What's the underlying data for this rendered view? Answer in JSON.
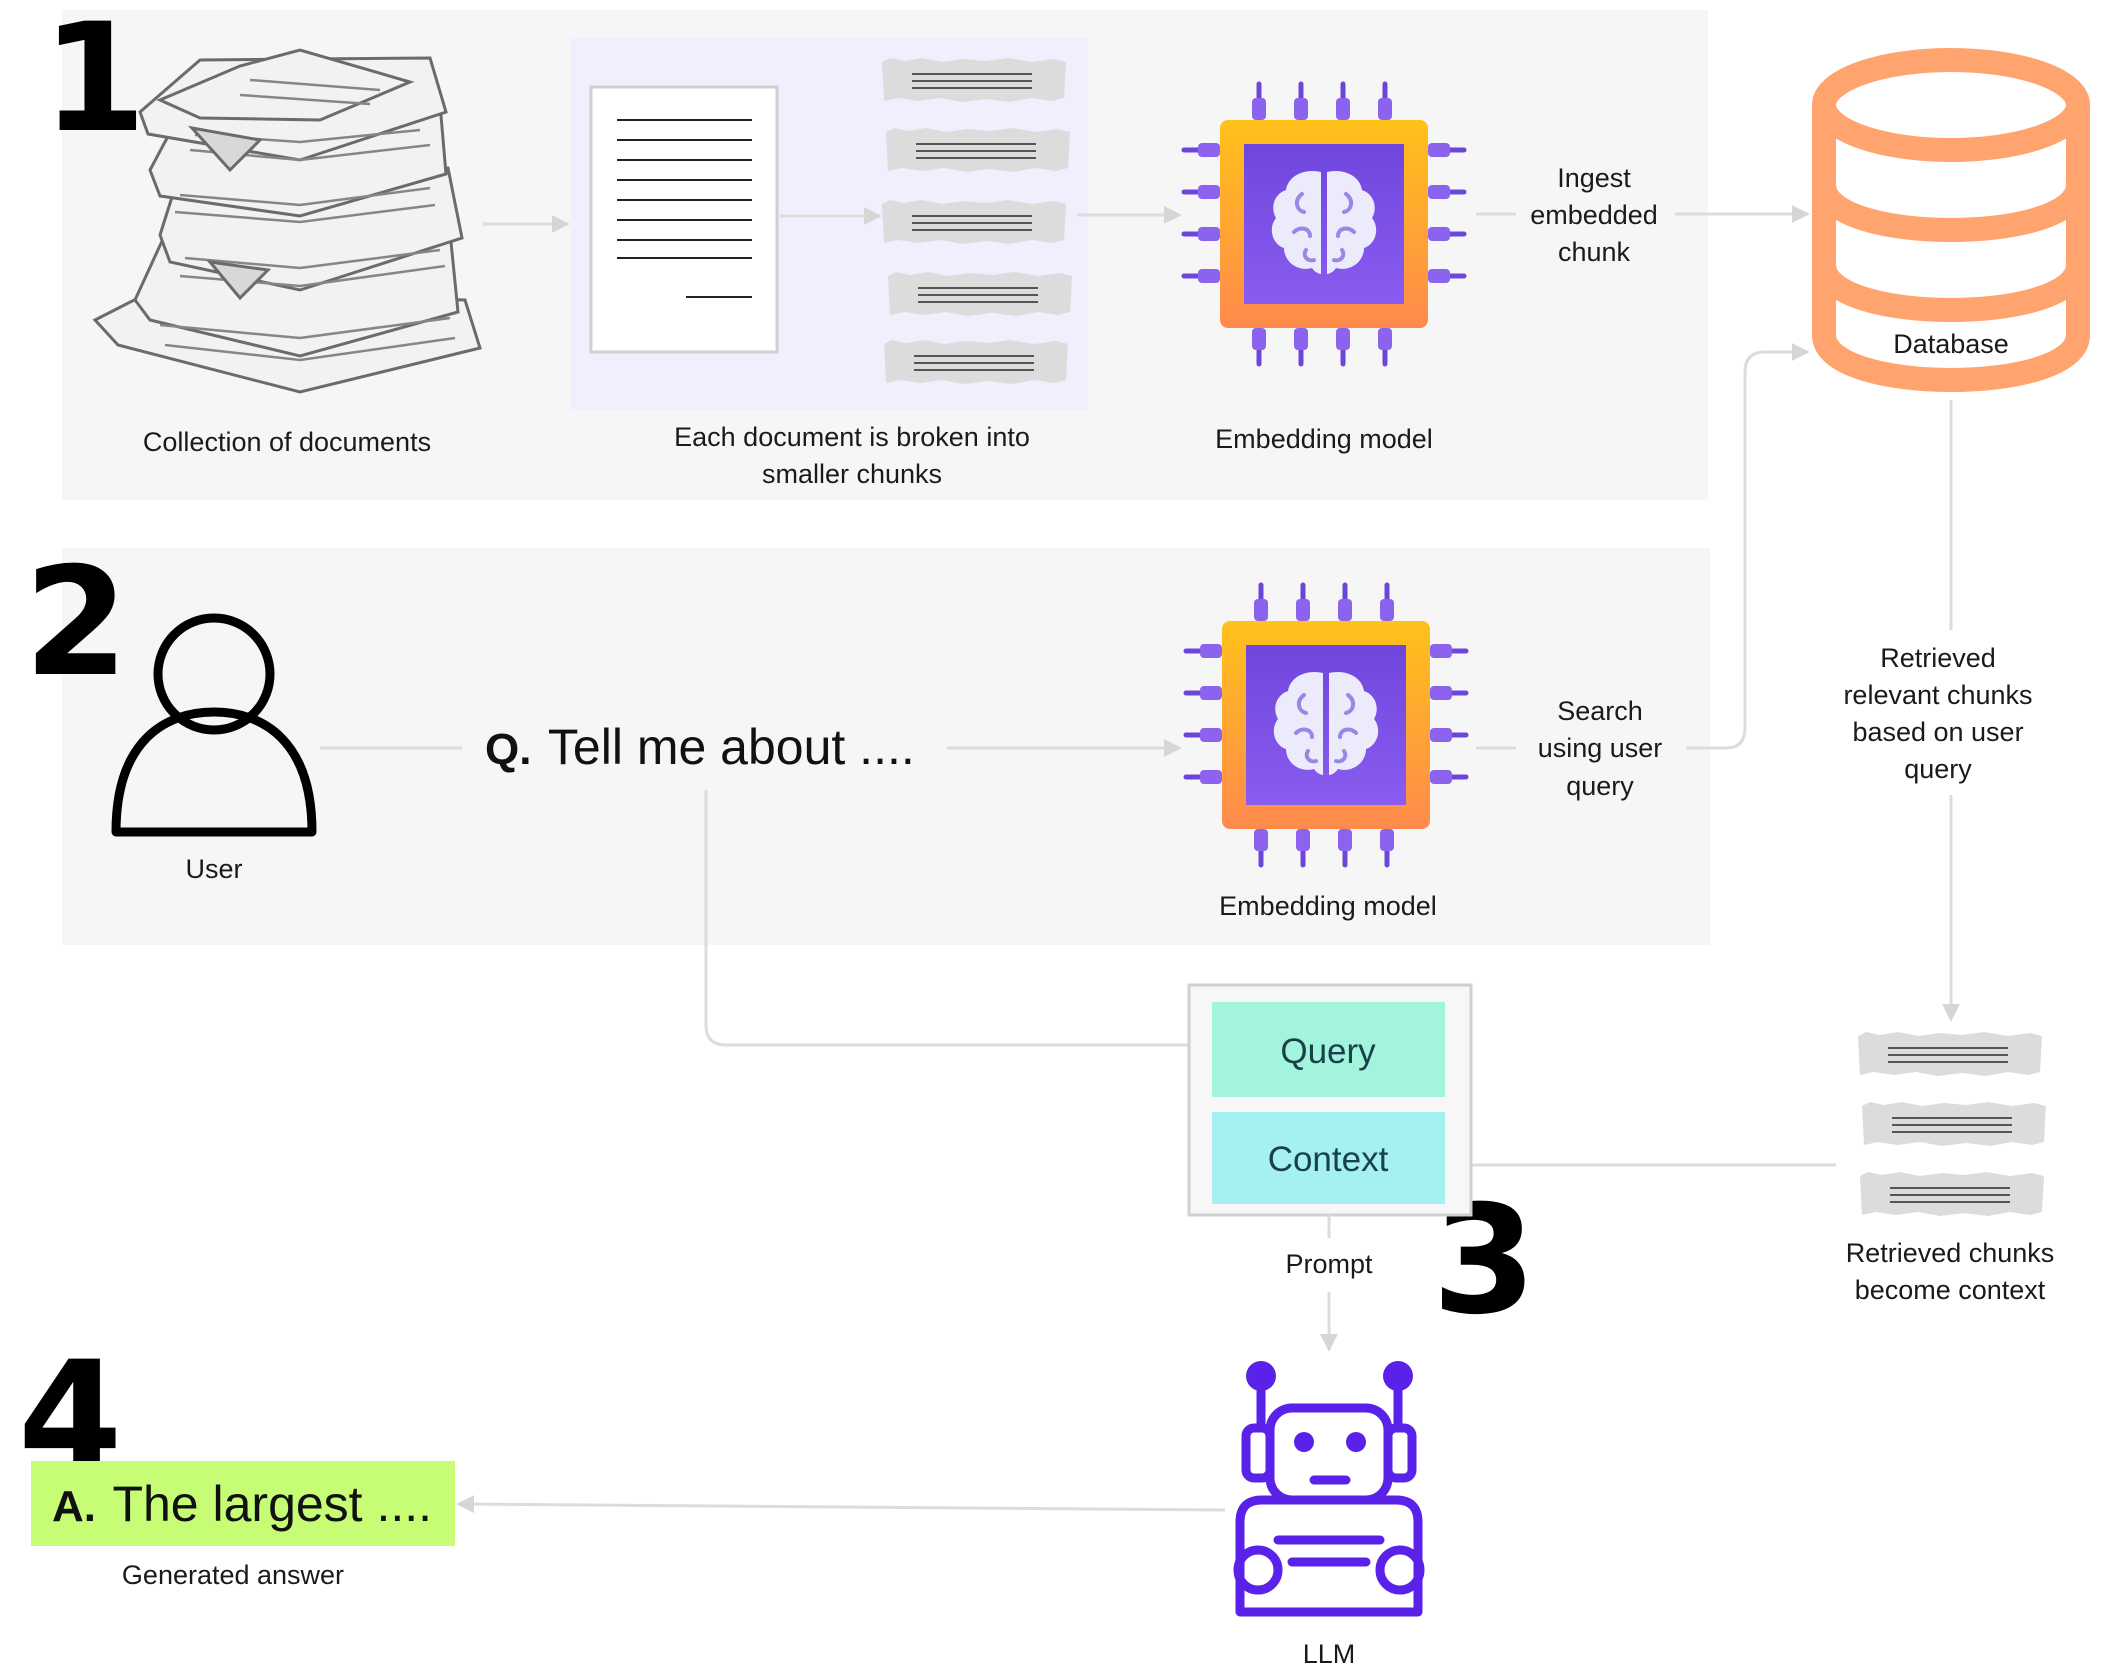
{
  "steps": {
    "one": "1",
    "two": "2",
    "three": "3",
    "four": "4"
  },
  "ingestion": {
    "documents_label": "Collection of  documents",
    "chunking_label_line1": "Each document is broken into",
    "chunking_label_line2": "smaller chunks",
    "embedding_label": "Embedding model",
    "ingest_line1": "Ingest",
    "ingest_line2": "embedded",
    "ingest_line3": "chunk",
    "database_label": "Database"
  },
  "query": {
    "user_label": "User",
    "question_prefix": "Q.",
    "question_text": "Tell me about ....",
    "embedding_label": "Embedding model",
    "search_line1": "Search",
    "search_line2": "using user",
    "search_line3": "query"
  },
  "retrieval": {
    "line1": "Retrieved",
    "line2": "relevant chunks",
    "line3": "based on user",
    "line4": "query",
    "chunks_line1": "Retrieved chunks",
    "chunks_line2": "become context"
  },
  "prompt": {
    "query_label": "Query",
    "context_label": "Context",
    "prompt_label": "Prompt",
    "llm_label": "LLM"
  },
  "answer": {
    "prefix": "A.",
    "text": "The largest ....",
    "label": "Generated answer"
  },
  "colors": {
    "panel_bg": "#f6f6f6",
    "chunk_panel_bg": "#f0effd",
    "database": "#ffa46e",
    "chip_outer": "#ffb020",
    "chip_inner": "#7b4fe0",
    "query_box": "#a3f4dd",
    "context_box": "#a5f0f0",
    "answer_highlight": "#c6fd75",
    "llm_robot": "#5a22e8"
  },
  "icons": [
    "document-stack-icon",
    "document-page-icon",
    "text-chunk-icon",
    "brain-chip-icon",
    "database-icon",
    "user-icon",
    "robot-icon"
  ]
}
